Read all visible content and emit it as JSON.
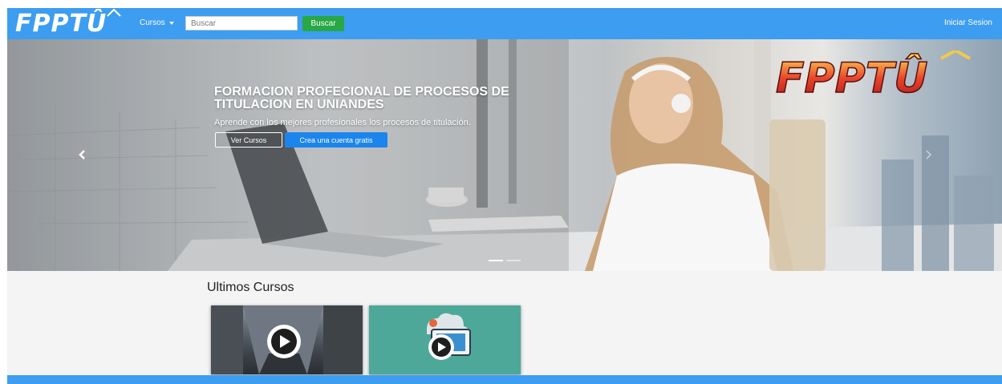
{
  "navbar": {
    "brand": "FPPTÛ",
    "courses_label": "Cursos",
    "search_placeholder": "Buscar",
    "search_button": "Buscar",
    "login_label": "Iniciar Sesion",
    "background_color": "#3d9df0"
  },
  "hero": {
    "title": "FORMACION PROFECIONAL DE PROCESOS DE TITULACION EN UNIANDES",
    "subtitle": "Aprende con los mejores profesionales los procesos de titulación.",
    "view_courses_button": "Ver Cursos",
    "create_account_button": "Crea una cuenta gratis",
    "brand_logo": "FPPTÛ",
    "slide_count": 2,
    "active_slide": 1
  },
  "latest": {
    "title": "Ultimos Cursos",
    "cards": [
      {
        "thumbnail": "street-photo-with-play-icon"
      },
      {
        "thumbnail": "cloud-monitor-play-illustration",
        "color": "#4da89a"
      }
    ]
  },
  "colors": {
    "accent": "#3d9df0",
    "success": "#28a745",
    "primary": "#1a85ec"
  }
}
